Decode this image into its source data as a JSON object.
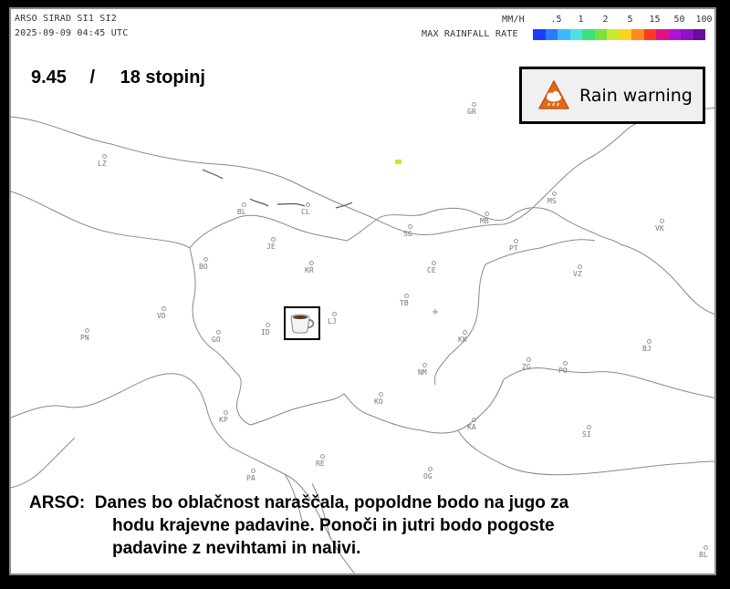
{
  "header": {
    "line1": "ARSO SIRAD SI1 SI2",
    "timestamp": "2025-09-09 04:45 UTC",
    "unit": "MM/H",
    "legend_title": "MAX RAINFALL RATE",
    "legend_ticks": [
      ".5",
      "1",
      "2",
      "5",
      "15",
      "50",
      "100"
    ],
    "legend_colors": [
      "#1e3cff",
      "#2a7bff",
      "#3fb6ff",
      "#4ce0e8",
      "#3ee07a",
      "#7ae23a",
      "#c8e832",
      "#ffd21e",
      "#ff8a1e",
      "#ff3a1e",
      "#e0128a",
      "#b012d8",
      "#8a12c8",
      "#6a0aa0"
    ]
  },
  "overlay": {
    "time": "9.45",
    "separator": "/",
    "temperature": "18 stopinj"
  },
  "warning": {
    "label": "Rain warning",
    "icon": "rain-warning-icon",
    "icon_color": "#e06a1a"
  },
  "stations": [
    {
      "code": "LZ"
    },
    {
      "code": "GR"
    },
    {
      "code": "MS"
    },
    {
      "code": "BL"
    },
    {
      "code": "CL"
    },
    {
      "code": "MB"
    },
    {
      "code": "SG"
    },
    {
      "code": "JE"
    },
    {
      "code": "PT"
    },
    {
      "code": "VK"
    },
    {
      "code": "BO"
    },
    {
      "code": "KR"
    },
    {
      "code": "CE"
    },
    {
      "code": "VZ"
    },
    {
      "code": "TB"
    },
    {
      "code": "VD"
    },
    {
      "code": "LJ"
    },
    {
      "code": "PN"
    },
    {
      "code": "GO"
    },
    {
      "code": "ID"
    },
    {
      "code": "KK"
    },
    {
      "code": "BJ"
    },
    {
      "code": "NM"
    },
    {
      "code": "ZG"
    },
    {
      "code": "PO"
    },
    {
      "code": "KO"
    },
    {
      "code": "KP"
    },
    {
      "code": "KA"
    },
    {
      "code": "SI"
    },
    {
      "code": "RE"
    },
    {
      "code": "PA"
    },
    {
      "code": "OG"
    },
    {
      "code": "BL"
    }
  ],
  "forecast": {
    "prefix": "ARSO:",
    "line1": "Danes bo oblačnost naraščala, popoldne bodo na jugo za",
    "line2": "hodu krajevne padavine. Ponoči in jutri bodo pogoste",
    "line3": "padavine z nevihtami in nalivi."
  }
}
